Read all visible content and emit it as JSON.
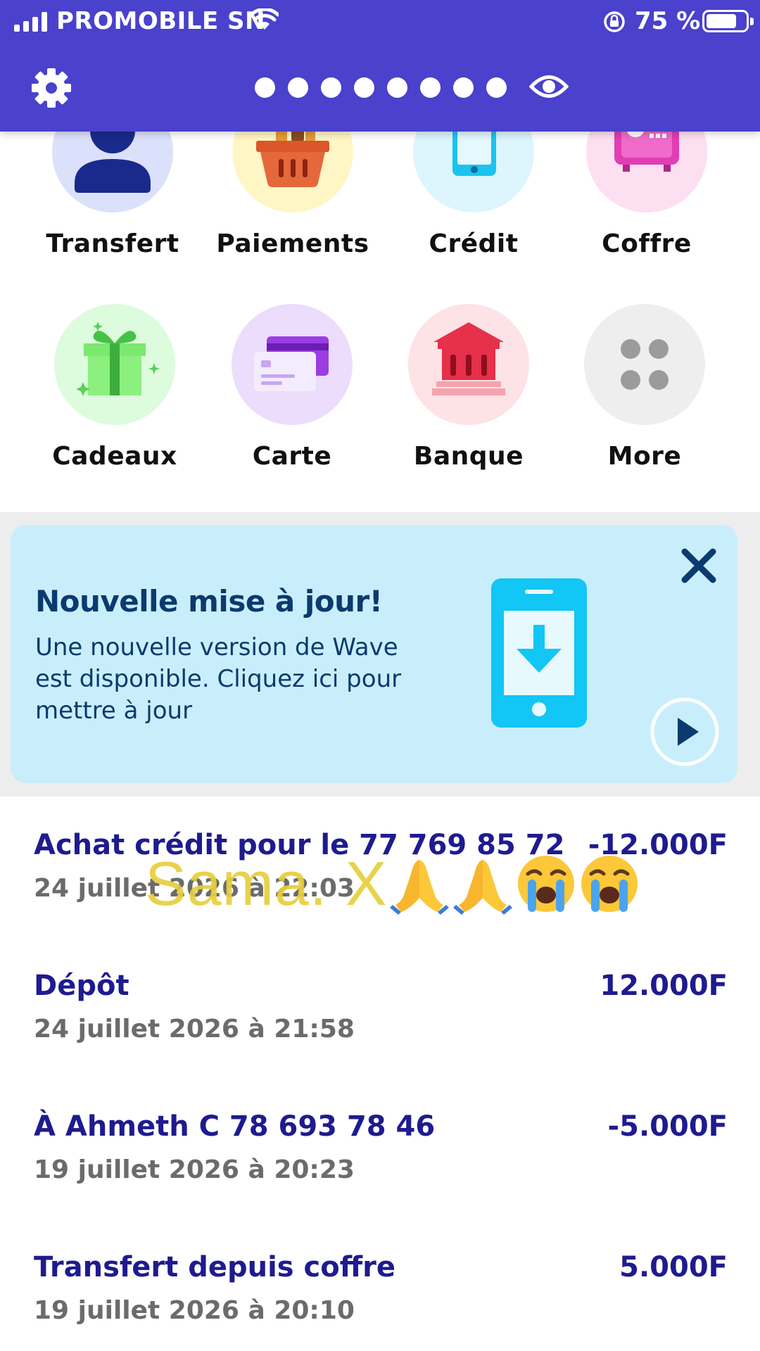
{
  "status_bar": {
    "carrier": "PROMOBILE SN",
    "battery": "75 %",
    "battery_level": 0.75
  },
  "header": {
    "masked_balance_dots": 8,
    "settings_icon": "gear-icon",
    "visibility_icon": "eye-icon"
  },
  "actions": [
    {
      "label": "Transfert",
      "icon": "person-icon"
    },
    {
      "label": "Paiements",
      "icon": "shopping-basket-icon"
    },
    {
      "label": "Crédit",
      "icon": "phone-icon"
    },
    {
      "label": "Coffre",
      "icon": "safe-icon"
    },
    {
      "label": "Cadeaux",
      "icon": "gift-icon"
    },
    {
      "label": "Carte",
      "icon": "card-icon"
    },
    {
      "label": "Banque",
      "icon": "bank-icon"
    },
    {
      "label": "More",
      "icon": "more-icon"
    }
  ],
  "banner": {
    "title": "Nouvelle mise à jour!",
    "text": "Une nouvelle version de Wave est disponible. Cliquez ici pour mettre à jour"
  },
  "transactions": [
    {
      "title": "Achat crédit pour le 77 769 85 72",
      "amount": "-12.000F",
      "date": "24 juillet 2026 à 22:03"
    },
    {
      "title": "Dépôt",
      "amount": "12.000F",
      "date": "24 juillet 2026 à 21:58"
    },
    {
      "title": "À Ahmeth C 78 693 78 46",
      "amount": "-5.000F",
      "date": "19 juillet 2026 à 20:23"
    },
    {
      "title": "Transfert depuis coffre",
      "amount": "5.000F",
      "date": "19 juillet 2026 à 20:10"
    }
  ],
  "overlay": {
    "text": "Sama. X",
    "emojis": [
      "folded-hands-icon",
      "folded-hands-icon",
      "crying-face-icon",
      "crying-face-icon"
    ]
  },
  "colors": {
    "header": "#4A41CC",
    "text_primary": "#1E1B8F",
    "banner_bg": "#C9EEFB",
    "overlay_text": "#E8CF3C"
  }
}
